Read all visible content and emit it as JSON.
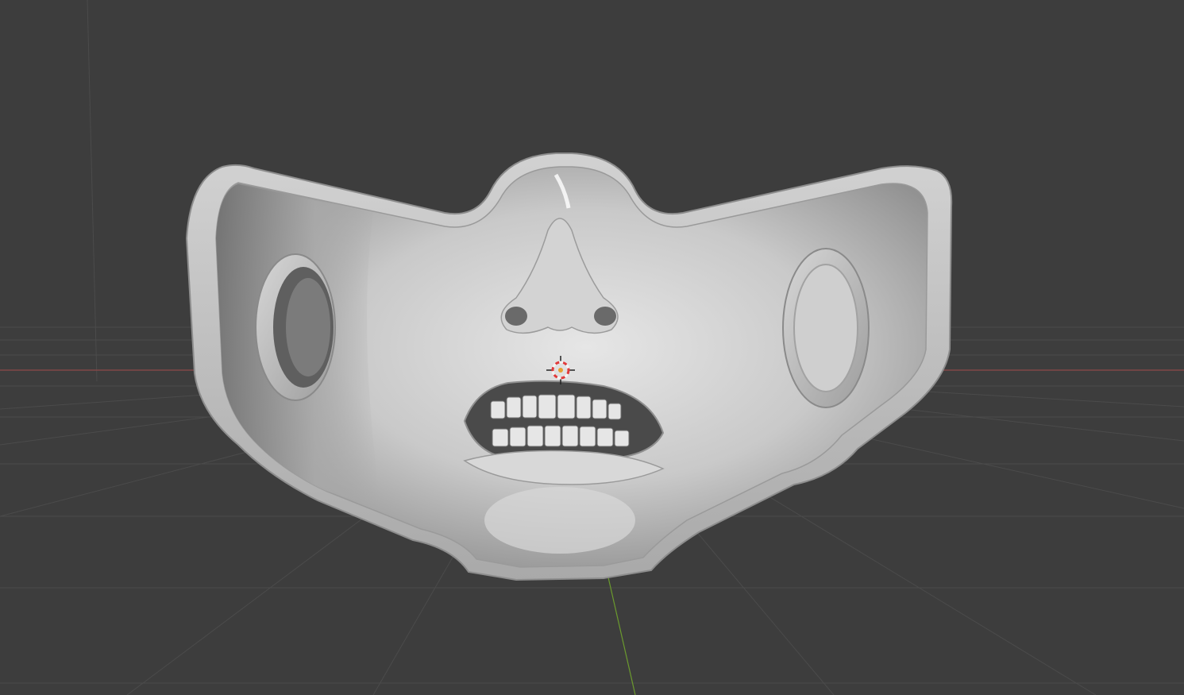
{
  "viewport": {
    "background_color": "#3d3d3d",
    "grid_color": "#4a4a4a",
    "x_axis_color": "#9e4a4a",
    "y_axis_color": "#6b9a2e"
  },
  "model": {
    "material_color": "#c8c8c8",
    "rim_color": "#b9b9b9",
    "shadow_color": "#555555"
  },
  "cursor": {
    "icon": "3d-cursor-icon",
    "ring_color_a": "#e03a3a",
    "ring_color_b": "#f4f4f4"
  }
}
